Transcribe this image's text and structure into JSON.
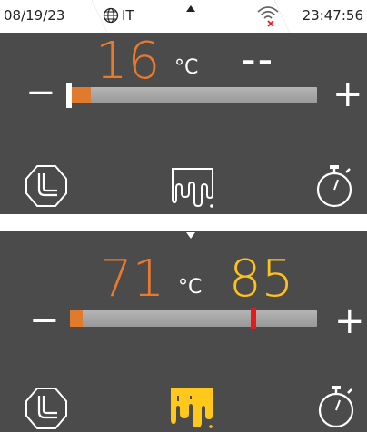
{
  "status": {
    "date": "08/19/23",
    "language": "IT",
    "time": "23:47:56",
    "wifi_alert_color": "#e02020"
  },
  "top_panel": {
    "current_temp": "16",
    "unit": "°C",
    "target": "--",
    "minus_label": "−",
    "plus_label": "+",
    "slider_fill_fraction": 0.09,
    "slider_thumb_position": 0.0,
    "current_color": "#e87a2e",
    "icons": [
      "probe-icon",
      "dripping-icon",
      "timer-icon"
    ]
  },
  "bottom_panel": {
    "current_temp": "71",
    "unit": "°C",
    "target": "85",
    "minus_label": "−",
    "plus_label": "+",
    "slider_fill_fraction": 0.05,
    "slider_marker_position": 0.74,
    "current_color": "#e87a2e",
    "target_color": "#ffc21a",
    "marker_color": "#e51a1a",
    "active_icon_color": "#ffc81a",
    "icons": [
      "probe-icon",
      "dripping-icon-active",
      "timer-icon"
    ]
  }
}
